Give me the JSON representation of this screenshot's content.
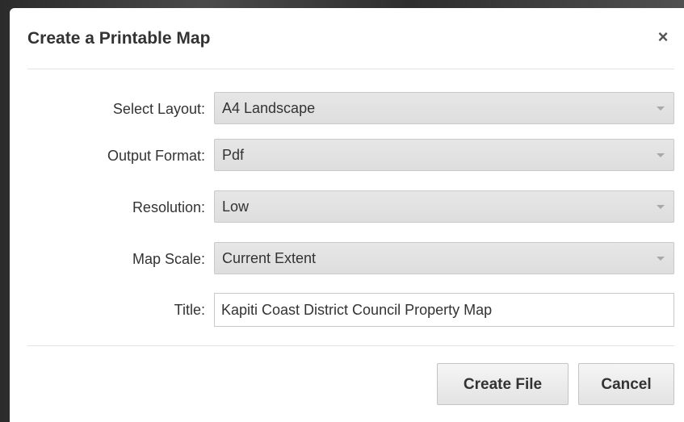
{
  "dialog": {
    "title": "Create a Printable Map",
    "close_glyph": "×"
  },
  "form": {
    "layout": {
      "label": "Select Layout:",
      "value": "A4 Landscape"
    },
    "format": {
      "label": "Output Format:",
      "value": "Pdf"
    },
    "resolution": {
      "label": "Resolution:",
      "value": "Low"
    },
    "scale": {
      "label": "Map Scale:",
      "value": "Current Extent"
    },
    "title": {
      "label": "Title:",
      "value": "Kapiti Coast District Council Property Map"
    }
  },
  "buttons": {
    "create_label": "Create File",
    "cancel_label": "Cancel"
  },
  "icons": {
    "close": "close-icon",
    "dropdown": "chevron-down-icon"
  }
}
